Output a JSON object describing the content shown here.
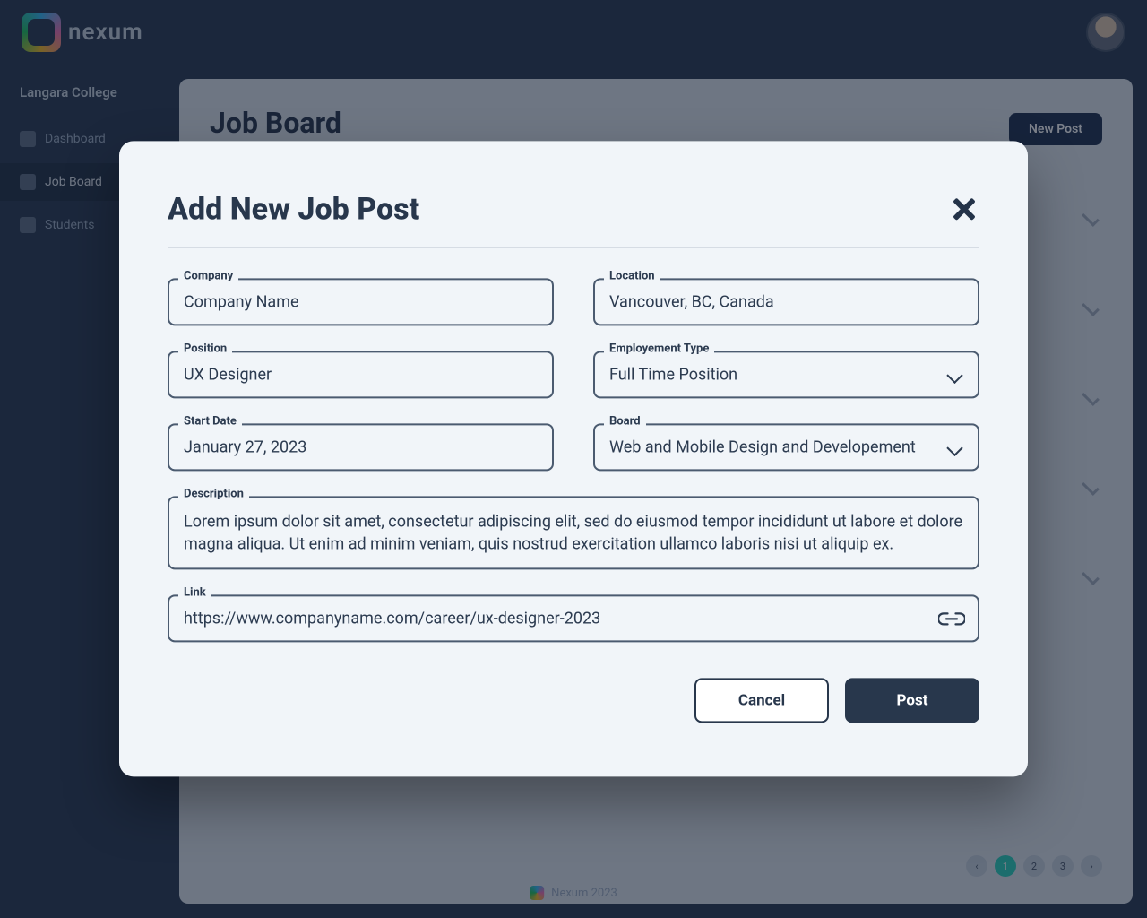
{
  "header": {
    "brand": "nexum",
    "footer": "Nexum 2023"
  },
  "sidebar": {
    "org": "Langara College",
    "items": [
      {
        "label": "Dashboard"
      },
      {
        "label": "Job Board"
      },
      {
        "label": "Students"
      }
    ]
  },
  "page_bg": {
    "title": "Job Board",
    "new_post_btn": "New Post",
    "pagination": [
      "‹",
      "1",
      "2",
      "3",
      "›"
    ],
    "pagination_active_index": 1
  },
  "modal": {
    "title": "Add New Job Post",
    "labels": {
      "company": "Company",
      "location": "Location",
      "position": "Position",
      "employment_type": "Employement Type",
      "start_date": "Start Date",
      "board": "Board",
      "description": "Description",
      "link": "Link"
    },
    "values": {
      "company": "Company Name",
      "location": "Vancouver, BC, Canada",
      "position": "UX Designer",
      "employment_type": "Full Time Position",
      "start_date": "January 27, 2023",
      "board": "Web and Mobile Design and Developement",
      "description": "Lorem ipsum dolor sit amet, consectetur adipiscing elit, sed do eiusmod tempor incididunt ut labore et dolore magna aliqua. Ut enim ad minim veniam, quis nostrud exercitation ullamco laboris nisi ut aliquip ex.",
      "link": "https://www.companyname.com/career/ux-designer-2023"
    },
    "actions": {
      "cancel": "Cancel",
      "post": "Post"
    }
  }
}
